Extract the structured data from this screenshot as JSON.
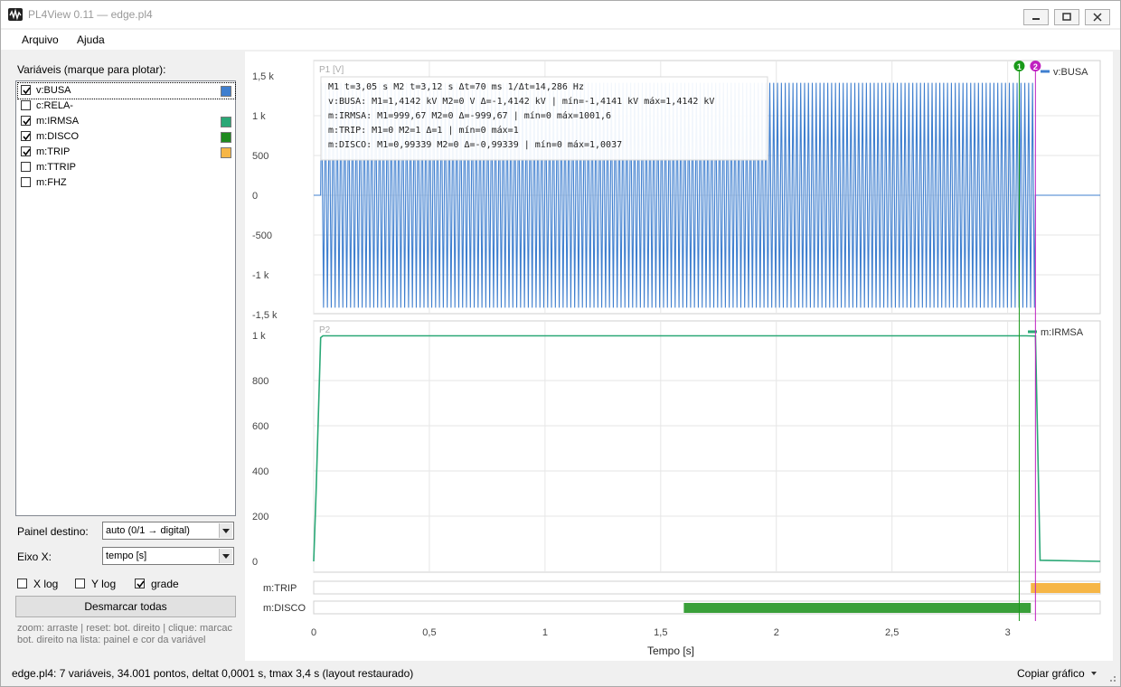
{
  "window": {
    "title": "PL4View 0.11 — edge.pl4",
    "icon": "waveform-icon",
    "controls": [
      "minimize-icon",
      "maximize-icon",
      "close-icon"
    ]
  },
  "menu": {
    "items": [
      {
        "label": "Arquivo"
      },
      {
        "label": "Ajuda"
      }
    ]
  },
  "sidebar": {
    "title": "Variáveis (marque para plotar):",
    "variables": [
      {
        "name": "v:BUSA",
        "checked": true,
        "color": "#3f7fcf",
        "selected": true
      },
      {
        "name": "c:RELA-",
        "checked": false,
        "color": ""
      },
      {
        "name": "m:IRMSA",
        "checked": true,
        "color": "#2aa876"
      },
      {
        "name": "m:DISCO",
        "checked": true,
        "color": "#1f8a1f"
      },
      {
        "name": "m:TRIP",
        "checked": true,
        "color": "#f6b646"
      },
      {
        "name": "m:TTRIP",
        "checked": false,
        "color": ""
      },
      {
        "name": "m:FHZ",
        "checked": false,
        "color": ""
      }
    ],
    "target_panel_label": "Painel destino:",
    "target_panel_value": "auto (0/1 → digital)",
    "xaxis_label": "Eixo X:",
    "xaxis_value": "tempo [s]",
    "xlog_label": "X log",
    "xlog_checked": false,
    "ylog_label": "Y log",
    "ylog_checked": false,
    "grid_label": "grade",
    "grid_checked": true,
    "clear_button": "Desmarcar todas",
    "hint_line1": "zoom: arraste | reset: bot. direito | clique: marcac",
    "hint_line2": "bot. direito na lista: painel e cor da variável"
  },
  "chart_data": [
    {
      "type": "line",
      "panel": "P1 [V]",
      "series": [
        {
          "name": "v:BUSA",
          "color": "#3f7fcf",
          "description_values": {
            "amplitude": 1414.2,
            "frequency_hz": 60,
            "t_start": 0.03,
            "t_end": 3.12,
            "value_after": 0
          }
        }
      ],
      "y_ticks": [
        "1,5 k",
        "1 k",
        "500",
        "0",
        "-500",
        "-1 k",
        "-1,5 k"
      ],
      "ylim": [
        -1500,
        1500
      ],
      "xlim": [
        0,
        3.4
      ],
      "legend": "top-right",
      "grid": true,
      "readout": [
        "M1 t=3,05 s   M2 t=3,12 s   Δt=70 ms   1/Δt=14,286 Hz",
        "v:BUSA:  M1=1,4142 kV  M2=0 V  Δ=-1,4142 kV  |  mín=-1,4141 kV  máx=1,4142 kV",
        "m:IRMSA:  M1=999,67  M2=0  Δ=-999,67  |  mín=0  máx=1001,6",
        "m:TRIP:  M1=0  M2=1  Δ=1  |  mín=0  máx=1",
        "m:DISCO:  M1=0,99339  M2=0  Δ=-0,99339  |  mín=0  máx=1,0037"
      ]
    },
    {
      "type": "line",
      "panel": "P2",
      "series": [
        {
          "name": "m:IRMSA",
          "color": "#2aa876",
          "x": [
            0,
            0.01,
            0.03,
            0.04,
            3.08,
            3.12,
            3.14,
            3.4
          ],
          "y": [
            0,
            300,
            990,
            998,
            998,
            997,
            5,
            0
          ]
        }
      ],
      "y_ticks": [
        "1 k",
        "800",
        "600",
        "400",
        "200",
        "0"
      ],
      "ylim": [
        -20,
        1010
      ],
      "xlim": [
        0,
        3.4
      ],
      "legend": "top-right",
      "grid": true
    },
    {
      "type": "digital",
      "series": [
        {
          "name": "m:TRIP",
          "color": "#f6b646",
          "on": [
            [
              3.1,
              3.4
            ]
          ]
        },
        {
          "name": "m:DISCO",
          "color": "#3aa03a",
          "on": [
            [
              1.6,
              3.1
            ]
          ]
        }
      ]
    }
  ],
  "x_axis": {
    "ticks": [
      "0",
      "0,5",
      "1",
      "1,5",
      "2",
      "2,5",
      "3"
    ],
    "tick_values": [
      0,
      0.5,
      1,
      1.5,
      2,
      2.5,
      3
    ],
    "label": "Tempo [s]"
  },
  "markers": [
    {
      "id": "1",
      "t": 3.05,
      "color": "#1a9a1a"
    },
    {
      "id": "2",
      "t": 3.12,
      "color": "#c020c0"
    }
  ],
  "status": {
    "text": "edge.pl4: 7 variáveis, 34.001 pontos, deltat 0,0001 s, tmax 3,4 s  (layout restaurado)",
    "copy_button": "Copiar gráfico"
  }
}
